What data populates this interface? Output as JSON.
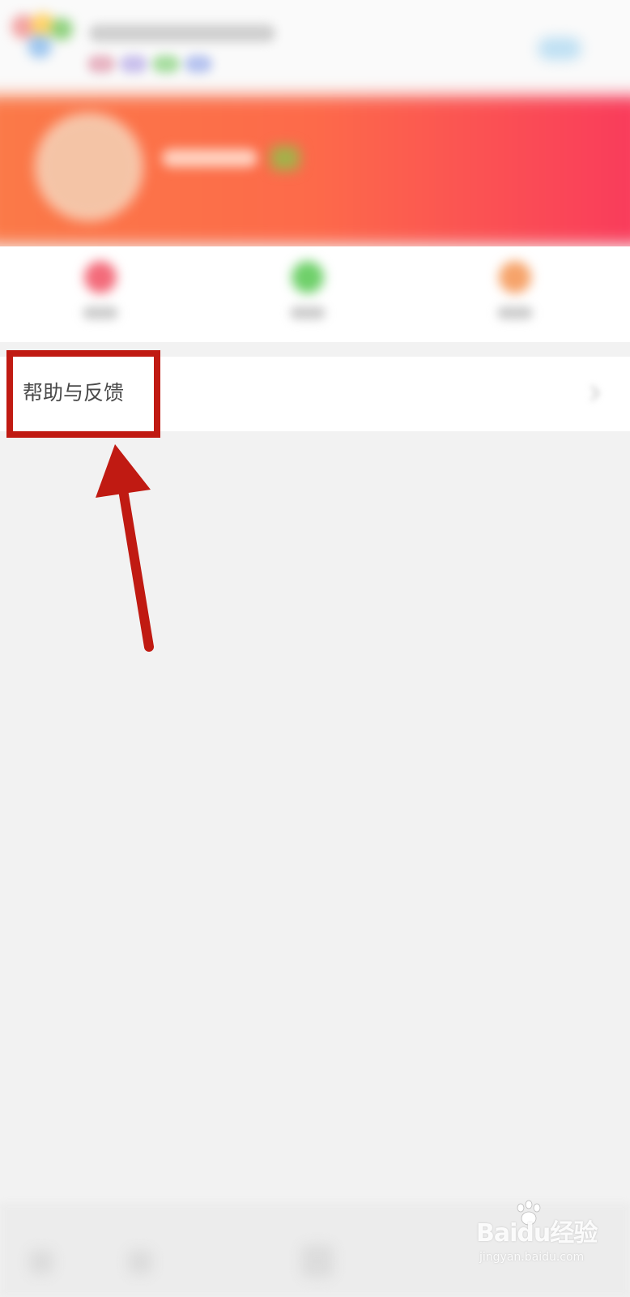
{
  "help_row": {
    "label": "帮助与反馈"
  },
  "watermark": {
    "brand_text": "Baidu经验",
    "url_text": "jingyan.baidu.com"
  },
  "colors": {
    "annotation_red": "#c01a12",
    "banner_start": "#fb7a48",
    "banner_end": "#f93a5c",
    "page_background": "#f2f2f2"
  },
  "icons": {
    "quick_actions": [
      "red-circle-icon",
      "green-circle-icon",
      "orange-circle-icon"
    ],
    "annotation": "arrow-pointer-icon",
    "watermark": "paw-icon"
  }
}
